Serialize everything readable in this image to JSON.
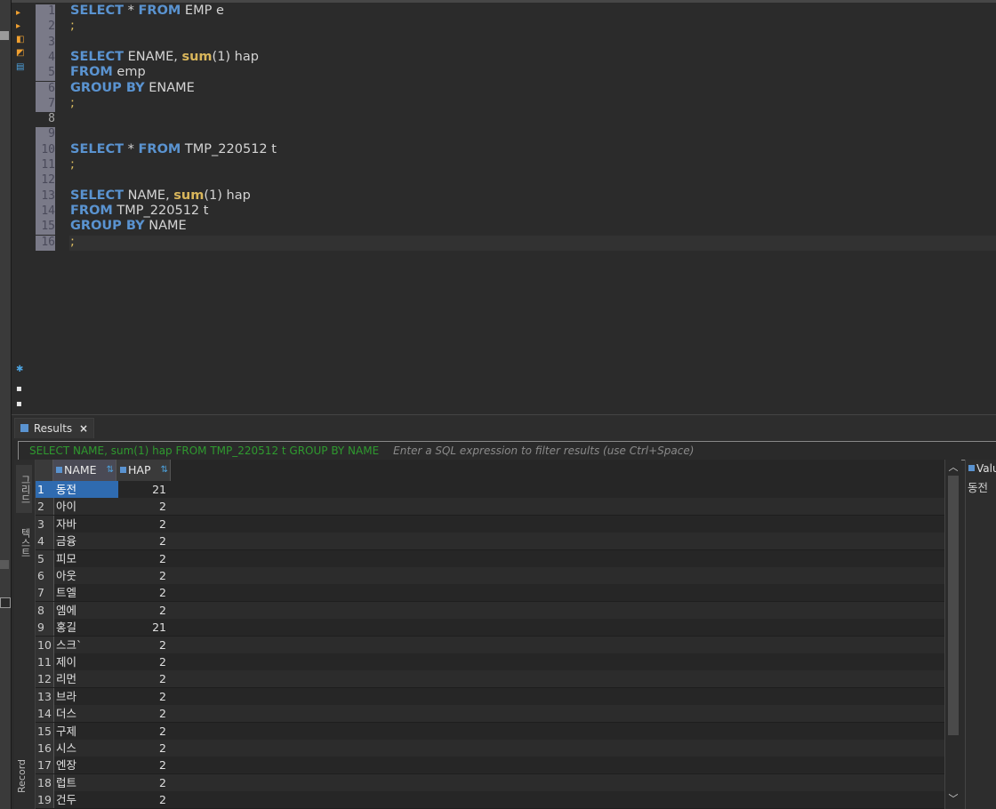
{
  "editor": {
    "lines": [
      {
        "n": "1",
        "tokens": [
          [
            "kw",
            "SELECT"
          ],
          [
            "t",
            " * "
          ],
          [
            "kw",
            "FROM"
          ],
          [
            "t",
            " EMP e"
          ]
        ]
      },
      {
        "n": "2",
        "tokens": [
          [
            "semi",
            ";"
          ]
        ]
      },
      {
        "n": "3",
        "tokens": []
      },
      {
        "n": "4",
        "tokens": [
          [
            "kw",
            "SELECT"
          ],
          [
            "t",
            " ENAME, "
          ],
          [
            "fn",
            "sum"
          ],
          [
            "t",
            "(1) hap"
          ]
        ]
      },
      {
        "n": "5",
        "tokens": [
          [
            "kw",
            "FROM"
          ],
          [
            "t",
            " emp"
          ]
        ]
      },
      {
        "n": "6",
        "tokens": [
          [
            "kw",
            "GROUP BY"
          ],
          [
            "t",
            " ENAME"
          ]
        ]
      },
      {
        "n": "7",
        "tokens": [
          [
            "semi",
            ";"
          ]
        ]
      },
      {
        "n": "8",
        "tokens": []
      },
      {
        "n": "9",
        "tokens": []
      },
      {
        "n": "10",
        "tokens": [
          [
            "kw",
            "SELECT"
          ],
          [
            "t",
            " * "
          ],
          [
            "kw",
            "FROM"
          ],
          [
            "t",
            " TMP_220512 t"
          ]
        ]
      },
      {
        "n": "11",
        "tokens": [
          [
            "semi",
            ";"
          ]
        ]
      },
      {
        "n": "12",
        "tokens": []
      },
      {
        "n": "13",
        "tokens": [
          [
            "kw",
            "SELECT"
          ],
          [
            "t",
            " NAME, "
          ],
          [
            "fn",
            "sum"
          ],
          [
            "t",
            "(1) hap"
          ]
        ]
      },
      {
        "n": "14",
        "tokens": [
          [
            "kw",
            "FROM"
          ],
          [
            "t",
            " TMP_220512 t"
          ]
        ]
      },
      {
        "n": "15",
        "tokens": [
          [
            "kw",
            "GROUP BY"
          ],
          [
            "t",
            " NAME"
          ]
        ]
      },
      {
        "n": "16",
        "tokens": [
          [
            "semi",
            ";"
          ]
        ]
      }
    ]
  },
  "results": {
    "tab_label": "Results",
    "tab_close": "×",
    "filter_sql": "SELECT NAME, sum(1) hap FROM TMP_220512 t GROUP BY NAME",
    "filter_placeholder": "Enter a SQL expression to filter results (use Ctrl+Space)",
    "columns": [
      "NAME",
      "HAP"
    ],
    "rows": [
      [
        "1",
        "동전",
        "21"
      ],
      [
        "2",
        "아이",
        "2"
      ],
      [
        "3",
        "자바",
        "2"
      ],
      [
        "4",
        "금융",
        "2"
      ],
      [
        "5",
        "피모",
        "2"
      ],
      [
        "6",
        "아웃",
        "2"
      ],
      [
        "7",
        "트엘",
        "2"
      ],
      [
        "8",
        "엠에",
        "2"
      ],
      [
        "9",
        "홍길",
        "21"
      ],
      [
        "10",
        "스크`",
        "2"
      ],
      [
        "11",
        "제이",
        "2"
      ],
      [
        "12",
        "리먼",
        "2"
      ],
      [
        "13",
        "브라",
        "2"
      ],
      [
        "14",
        "더스",
        "2"
      ],
      [
        "15",
        "구제",
        "2"
      ],
      [
        "16",
        "시스",
        "2"
      ],
      [
        "17",
        "엔장",
        "2"
      ],
      [
        "18",
        "럽트",
        "2"
      ],
      [
        "19",
        "건두",
        "2"
      ]
    ],
    "side_tabs": [
      "그리드",
      "텍스트",
      "Record"
    ],
    "value_panel_title": "Valu",
    "value_panel_content": "동전"
  },
  "colors": {
    "keyword": "#5a93d0",
    "function": "#d9b65b",
    "selection": "#2f6bb0",
    "filter_sql": "#2f9a2f"
  }
}
